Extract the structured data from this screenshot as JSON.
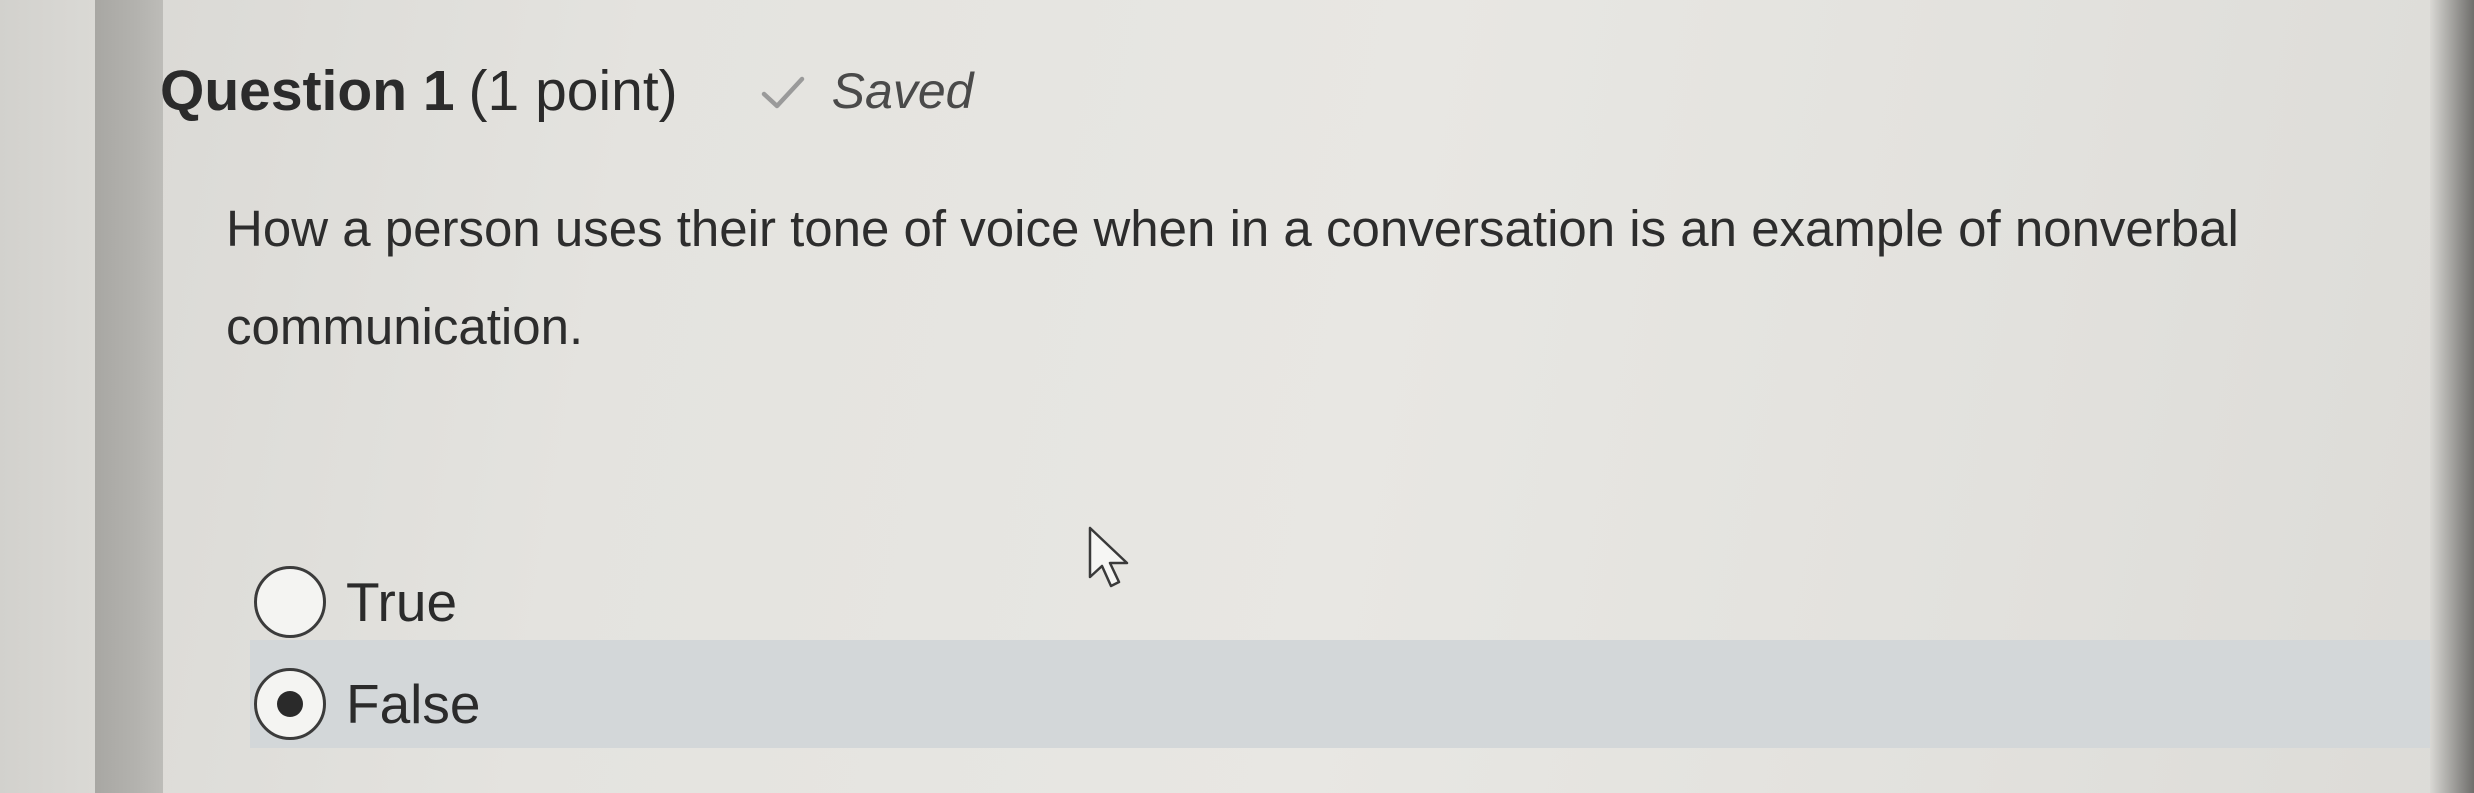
{
  "question": {
    "title": "Question 1",
    "points": "(1 point)",
    "status": "Saved",
    "status_icon": "checkmark-icon",
    "text": "How a person uses their tone of voice when in a conversation is an example of nonverbal communication."
  },
  "options": [
    {
      "label": "True",
      "selected": false
    },
    {
      "label": "False",
      "selected": true
    }
  ],
  "colors": {
    "selected_row_bg": "#d3d7d9",
    "text": "#2b2b2b"
  }
}
